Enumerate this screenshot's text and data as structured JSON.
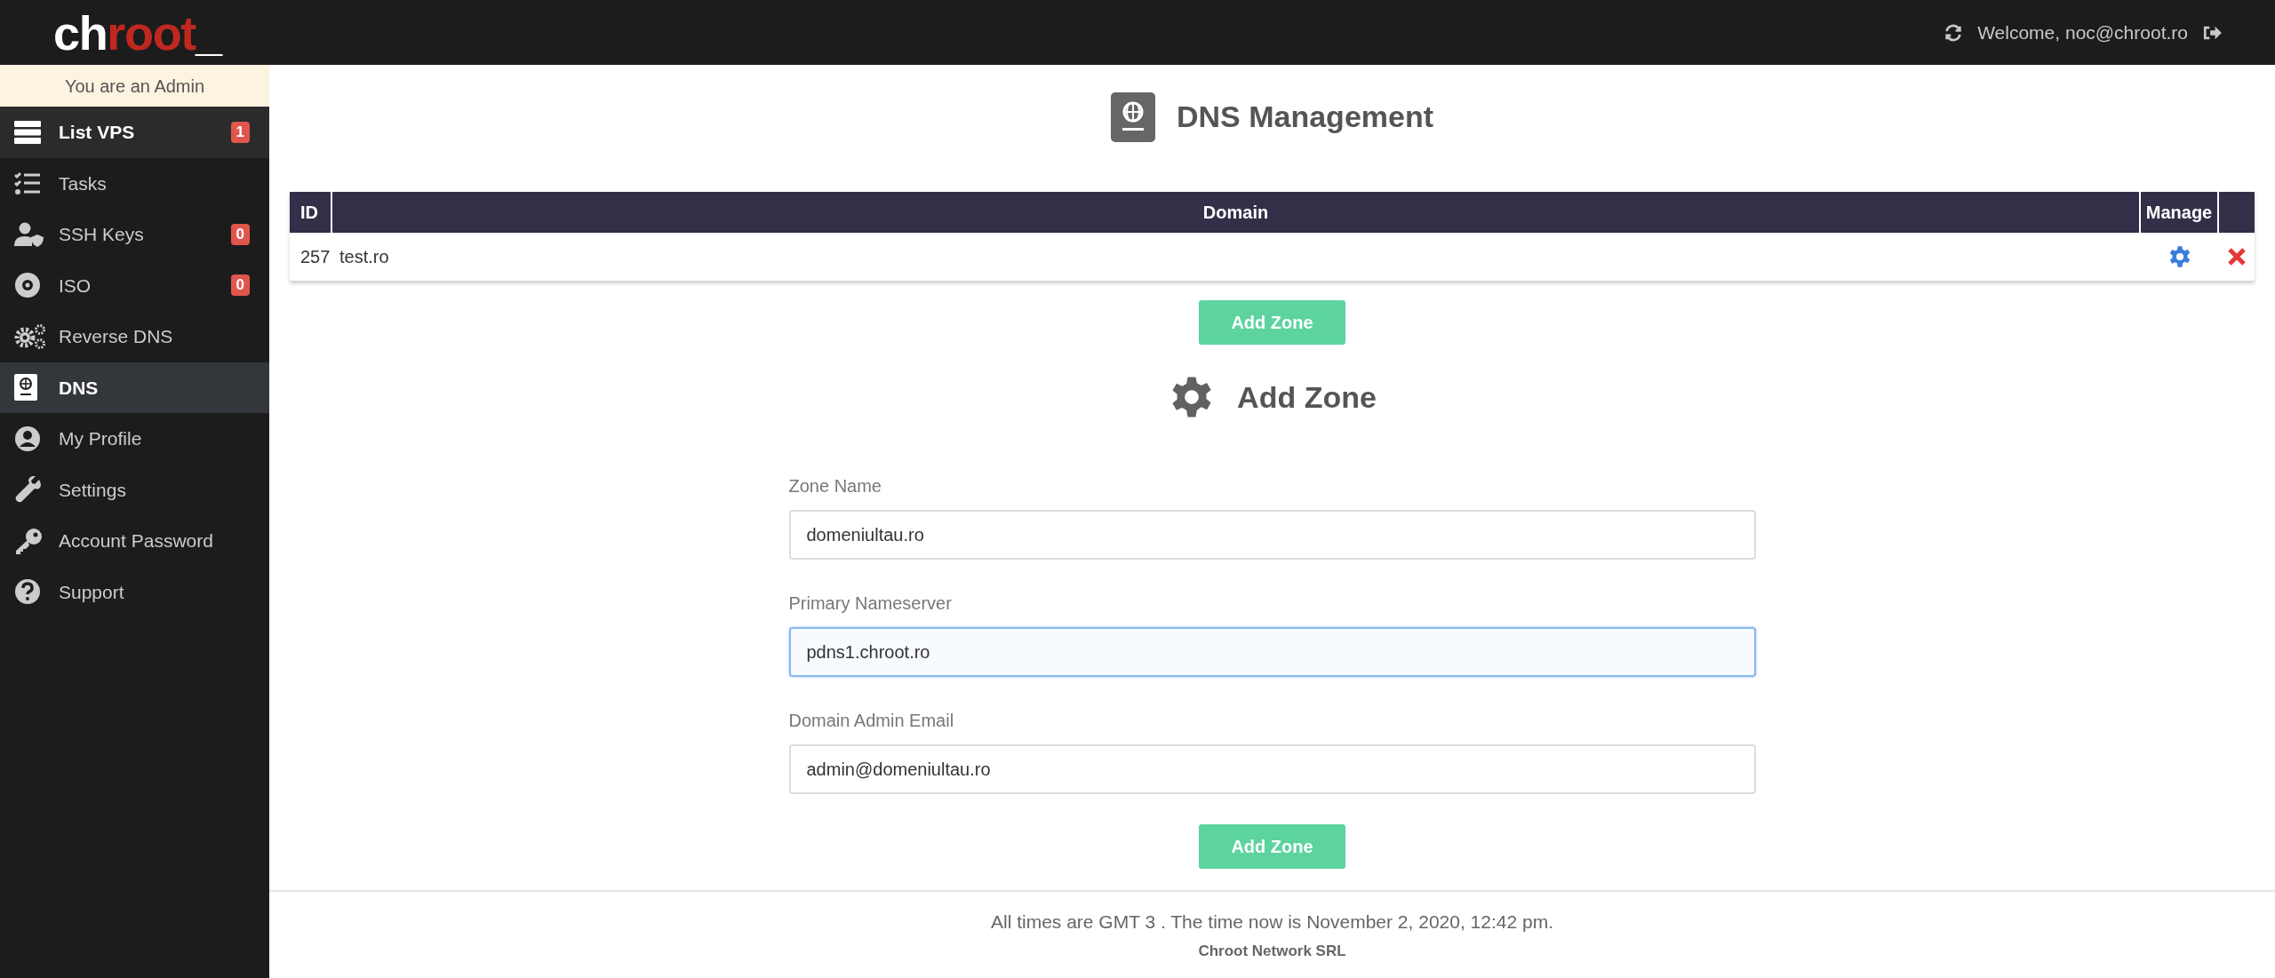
{
  "logo": {
    "parts": [
      {
        "text": "ch",
        "accent": false
      },
      {
        "text": "root",
        "accent": true
      },
      {
        "text": "_",
        "accent": false
      }
    ]
  },
  "topbar": {
    "welcome": "Welcome, noc@chroot.ro"
  },
  "sidebar": {
    "role_banner": "You are an Admin",
    "items": [
      {
        "label": "List VPS",
        "badge": "1",
        "selected": false,
        "hovered": true
      },
      {
        "label": "Tasks",
        "selected": false,
        "hovered": false
      },
      {
        "label": "SSH Keys",
        "badge": "0",
        "selected": false,
        "hovered": false
      },
      {
        "label": "ISO",
        "badge": "0",
        "selected": false,
        "hovered": false
      },
      {
        "label": "Reverse DNS",
        "selected": false,
        "hovered": false
      },
      {
        "label": "DNS",
        "selected": true,
        "hovered": false
      },
      {
        "label": "My Profile",
        "selected": false,
        "hovered": false
      },
      {
        "label": "Settings",
        "selected": false,
        "hovered": false
      },
      {
        "label": "Account Password",
        "selected": false,
        "hovered": false
      },
      {
        "label": "Support",
        "selected": false,
        "hovered": false
      }
    ]
  },
  "page_title": "DNS Management",
  "table": {
    "columns": [
      "ID",
      "Domain",
      "Manage"
    ],
    "rows": [
      {
        "id": "257",
        "domain": "test.ro"
      }
    ]
  },
  "add_zone_button": "Add Zone",
  "form": {
    "title": "Add Zone",
    "fields": [
      {
        "label": "Zone Name",
        "value": "domeniultau.ro",
        "focused": false
      },
      {
        "label": "Primary Nameserver",
        "value": "pdns1.chroot.ro",
        "focused": true
      },
      {
        "label": "Domain Admin Email",
        "value": "admin@domeniultau.ro",
        "focused": false
      }
    ],
    "submit": "Add Zone"
  },
  "footer": {
    "time_note": "All times are GMT 3 . The time now is November 2, 2020, 12:42 pm.",
    "company": "Chroot Network SRL"
  }
}
